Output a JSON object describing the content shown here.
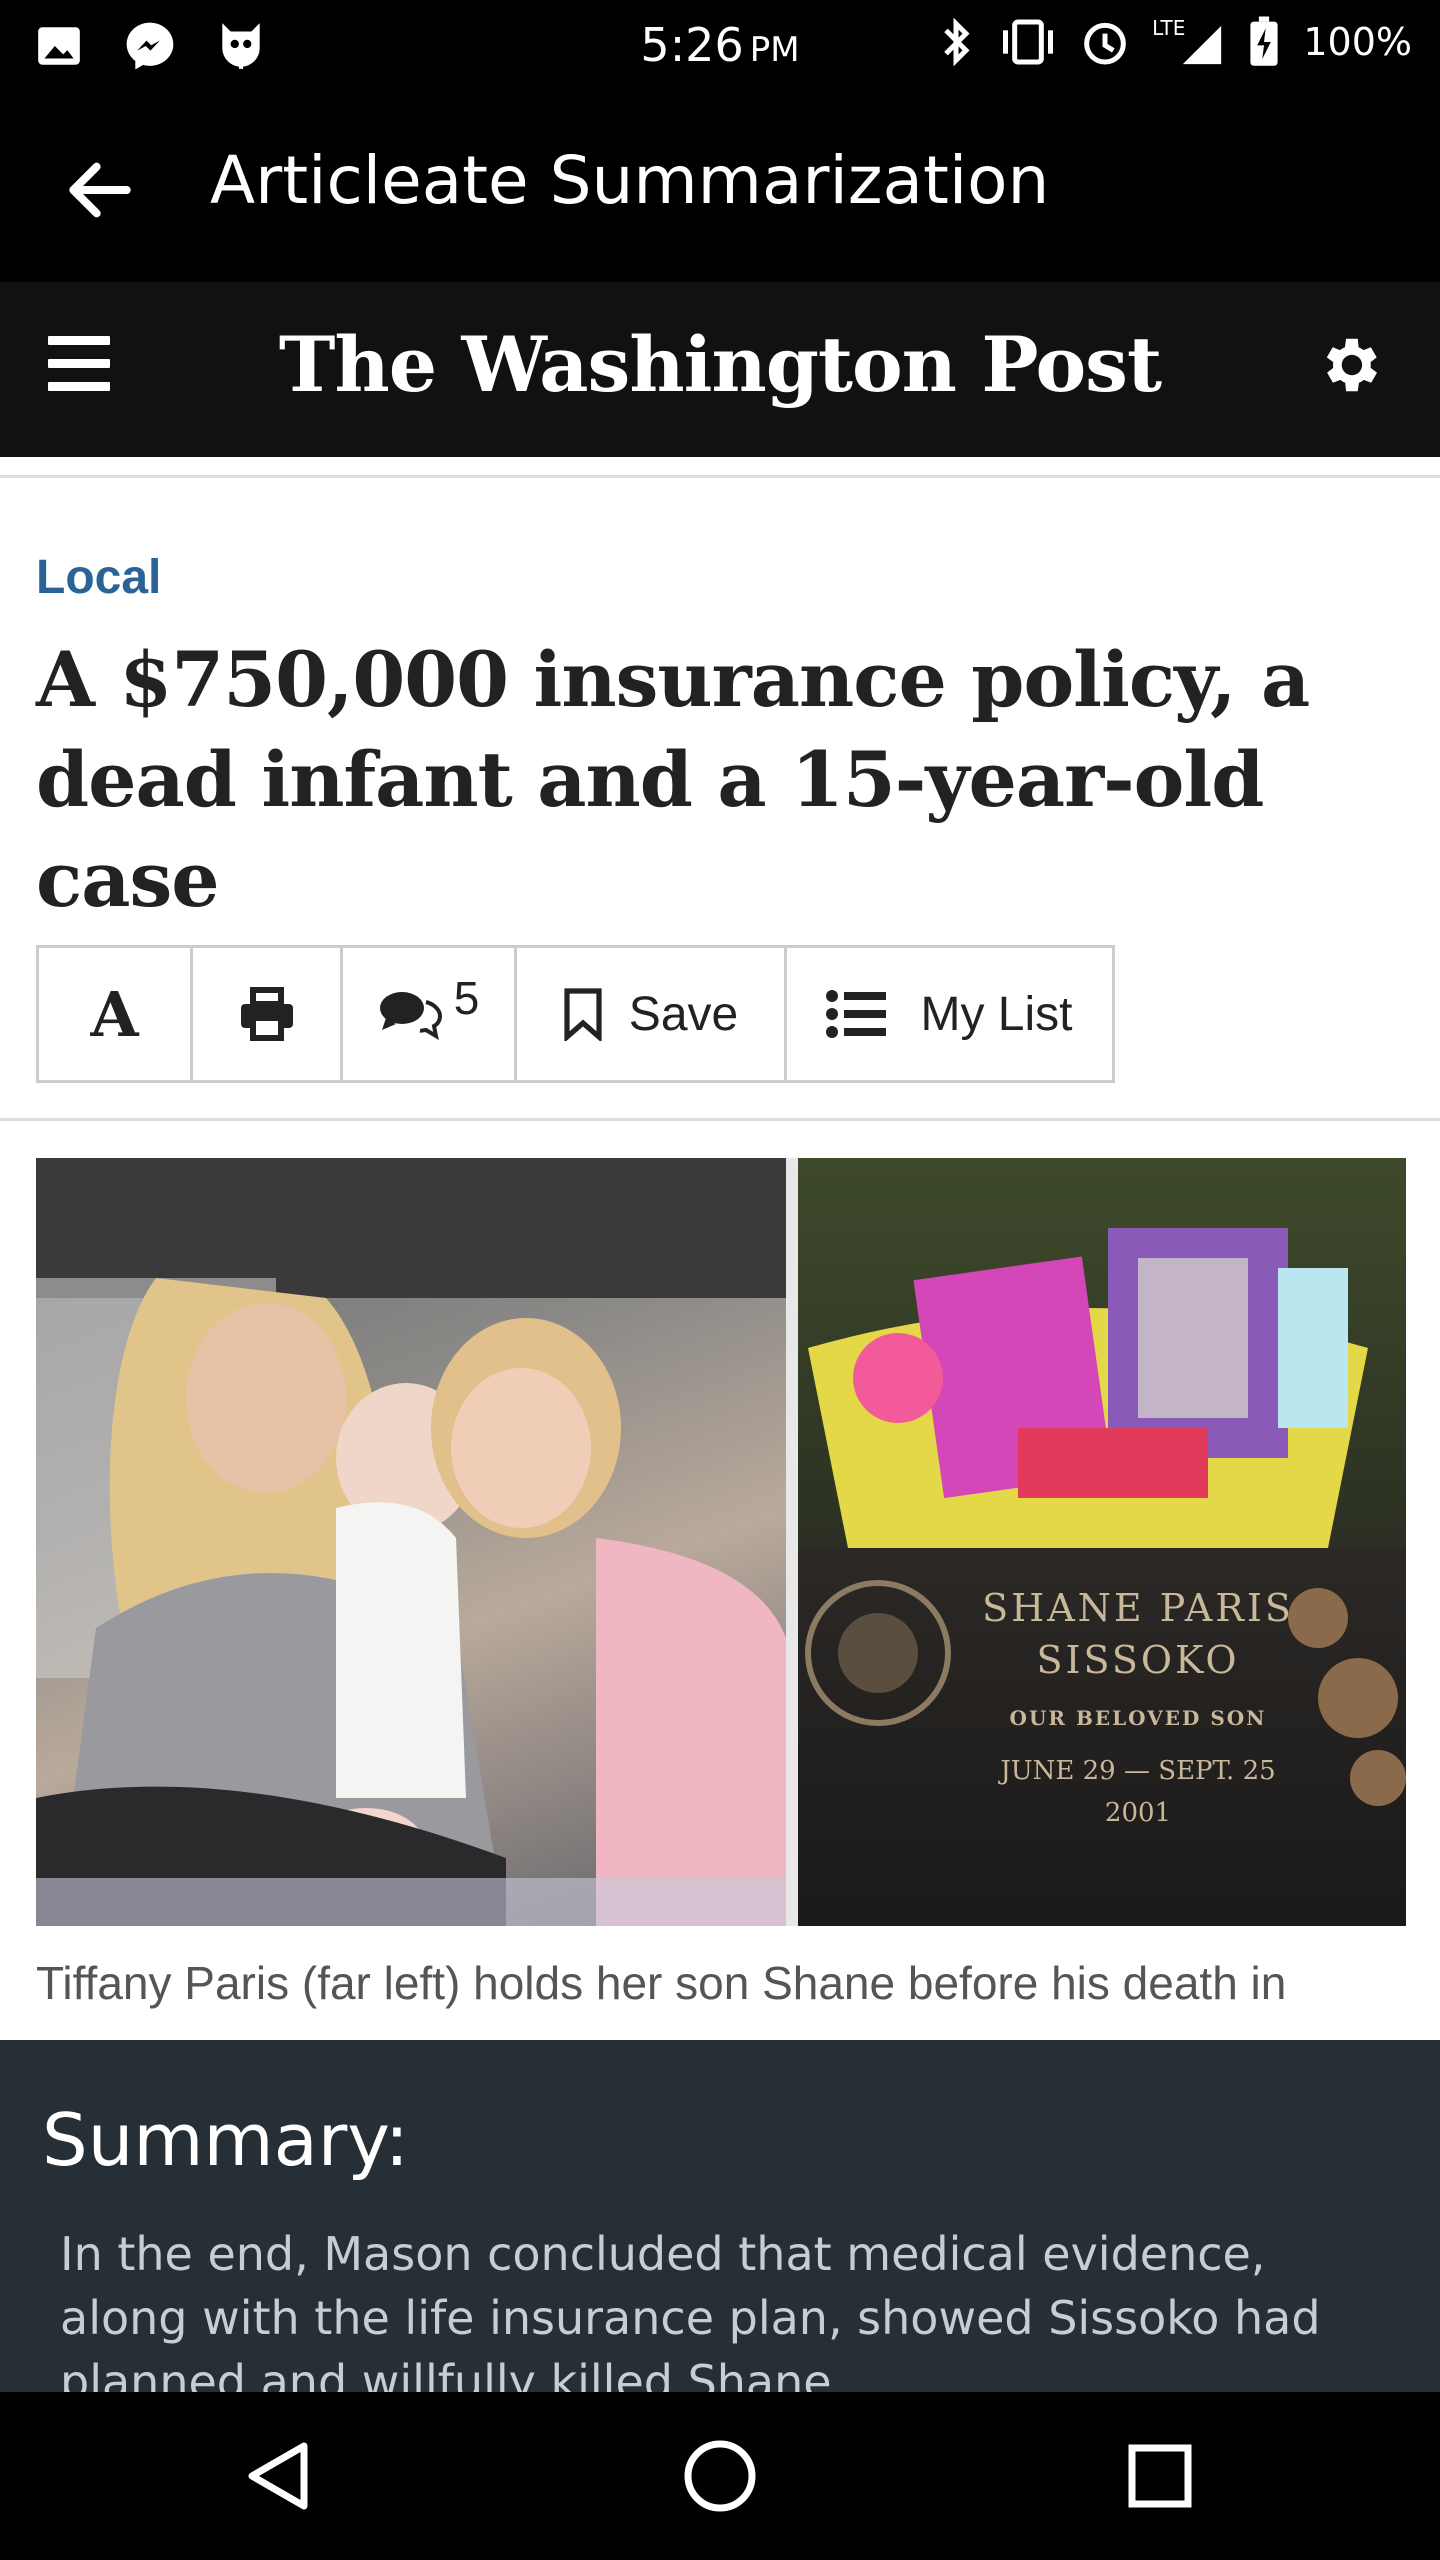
{
  "status_bar": {
    "time": "5:26",
    "ampm": "PM",
    "network": "LTE",
    "battery": "100%",
    "left_icons": [
      "gallery-icon",
      "messenger-icon",
      "cyanogen-icon"
    ],
    "right_icons": [
      "bluetooth-icon",
      "vibrate-icon",
      "alarm-icon",
      "signal-icon",
      "battery-charging-icon"
    ]
  },
  "app_bar": {
    "title": "Articleate Summarization"
  },
  "site_header": {
    "logo": "The Washington Post"
  },
  "article": {
    "kicker": "Local",
    "headline": "A $750,000 insurance policy, a dead infant and a 15-year-old case",
    "toolbar": {
      "font_label": "A",
      "comment_count": "5",
      "save_label": "Save",
      "list_label": "My List"
    },
    "photo": {
      "plaque_name_1": "SHANE PARIS",
      "plaque_name_2": "SISSOKO",
      "plaque_line": "OUR BELOVED SON",
      "plaque_dates": "JUNE 29 — SEPT. 25",
      "plaque_year": "2001"
    },
    "caption": "Tiffany Paris (far left) holds her son Shane before his death in"
  },
  "summary": {
    "title": "Summary:",
    "text": "In the end, Mason concluded that medical evidence, along with the life insurance plan, showed Sissoko had planned and willfully killed Shane."
  },
  "colors": {
    "kicker": "#2a6496",
    "summary_bg": "#262f35",
    "header_bg": "#111111"
  }
}
